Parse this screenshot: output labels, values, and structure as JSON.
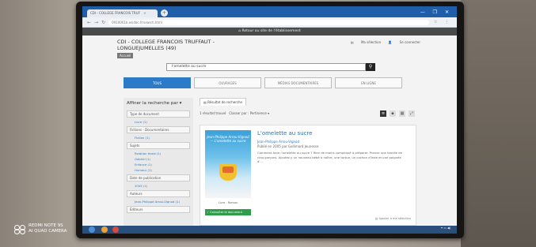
{
  "browser": {
    "tab_title": "CDI - COLLEGE FRANCOIS TRUF",
    "url": "0910061b.esidoc.fr/search.html",
    "win_controls": "— ❐ ✕"
  },
  "site": {
    "etab_bar": "Retour au site de l'établissement",
    "title": "CDI - COLLEGE FRANCOIS TRUFFAUT - LONGUEJUMELLES (49)",
    "accueil": "Accueil",
    "link_selection": "Ma sélection",
    "link_login": "Se connecter"
  },
  "search": {
    "query": "l'omelette au sucre"
  },
  "search_tabs": [
    "TOUS",
    "OUVRAGES",
    "MÉDIAS DOCUMENTAIRES",
    "EN LIGNE"
  ],
  "sidebar": {
    "title": "Affiner la recherche par",
    "facets": [
      {
        "label": "Type de document",
        "items": [
          "Livre (1)"
        ]
      },
      {
        "label": "Fictions - Documentaires",
        "items": [
          "Fiction (1)"
        ]
      },
      {
        "label": "Sujets",
        "items": [
          "Relation école (1)",
          "Gabriel (1)",
          "Enfance (1)",
          "Humour (1)"
        ]
      },
      {
        "label": "Date de publication",
        "items": [
          "2005 (1)"
        ]
      },
      {
        "label": "Auteurs",
        "items": [
          "Jean-Philippe Arrou-Vignod (1)"
        ]
      },
      {
        "label": "Éditeurs",
        "items": []
      }
    ]
  },
  "results": {
    "tab_label": "Résultat de recherche",
    "count_text": "1 résultat trouvé",
    "sort_label": "Classer par : Pertinence ▾"
  },
  "result": {
    "title": "L'omelette au sucre",
    "author": "Jean-Philippe Arrou-Vignod",
    "publication": "Publié en 2005 par Gallimard Jeunesse",
    "description": "Comment faire l'omelette au sucre ? Rien de moins compliqué à préparer. Prenez une famille de cinq garçons. Ajoutez-y un nouveau bébé à naître, une tortue, un cochon d'Inde et une poignée d'...",
    "cover_title": "Jean-Philippe Arrou-Vignod — L'omelette au sucre",
    "cover_caption": "Livre - Roman",
    "availability": "Consulter le document",
    "add_selection": "Ajouter à ma sélection"
  },
  "watermark": {
    "line1": "REDMI NOTE 9S",
    "line2": "AI QUAD CAMERA"
  }
}
